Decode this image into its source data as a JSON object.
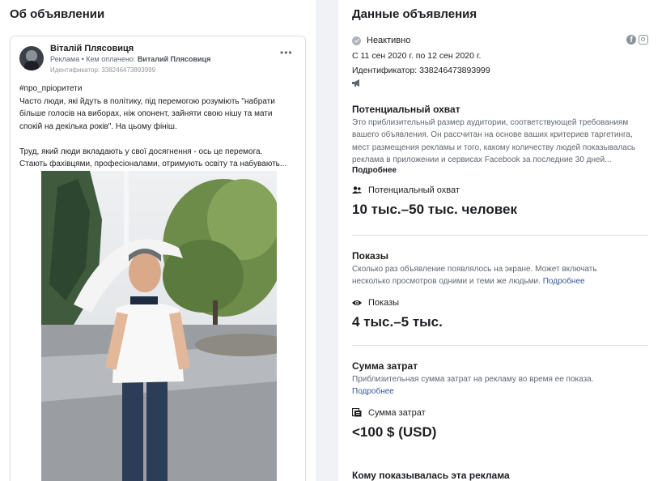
{
  "left": {
    "title": "Об объявлении",
    "post": {
      "page_name": "Віталій Плясовиця",
      "sponsor_prefix": "Реклама • Кем оплачено: ",
      "sponsor_name": "Виталий Плясовиця",
      "id_line": "Идентификатор: 338246473893999",
      "more_icon": "•••",
      "text_lines": [
        "#про_пріоритети",
        "Часто люди, які йдуть в політику, під перемогою розуміють \"набрати",
        "більше голосів на виборах, ніж опонент, зайняти свою нішу та мати",
        "спокій на декілька років\". На цьому фініш.",
        "",
        "Труд, який люди вкладають у свої досягнення - ось це перемога.",
        "Стають фахівцями, професіоналами, отримують освіту та набувають..."
      ]
    }
  },
  "right": {
    "title": "Данные объявления",
    "status": "Неактивно",
    "dates": "С 11 сен 2020 г. по 12 сен 2020 г.",
    "id_line": "Идентификатор: 338246473893999",
    "icons": [
      "facebook-icon",
      "instagram-icon",
      "megaphone-icon"
    ],
    "reach": {
      "heading": "Потенциальный охват",
      "desc_lines": [
        "Это приблизительный размер аудитории, соответствующей требованиям",
        "вашего объявления. Он рассчитан на основе ваших критериев таргетинга,",
        "мест размещения рекламы и того, какому количеству людей показывалась",
        "реклама в приложении и сервисах Facebook за последние 30 дней..."
      ],
      "more": "Подробнее",
      "label": "Потенциальный охват",
      "value": "10 тыс.–50 тыс. человек"
    },
    "impressions": {
      "heading": "Показы",
      "desc_line1": "Сколько раз объявление появлялось на экране. Может включать",
      "desc_line2": "несколько просмотров одними и теми же людьми.",
      "link": "Подробнее",
      "label": "Показы",
      "value": "4 тыс.–5 тыс."
    },
    "spend": {
      "heading": "Сумма затрат",
      "desc_line1": "Приблизительная сумма затрат на рекламу во время ее показа.",
      "link": "Подробнее",
      "label": "Сумма затрат",
      "value": "<100 $ (USD)"
    },
    "audience": {
      "heading": "Кому показывалась эта реклама"
    }
  }
}
